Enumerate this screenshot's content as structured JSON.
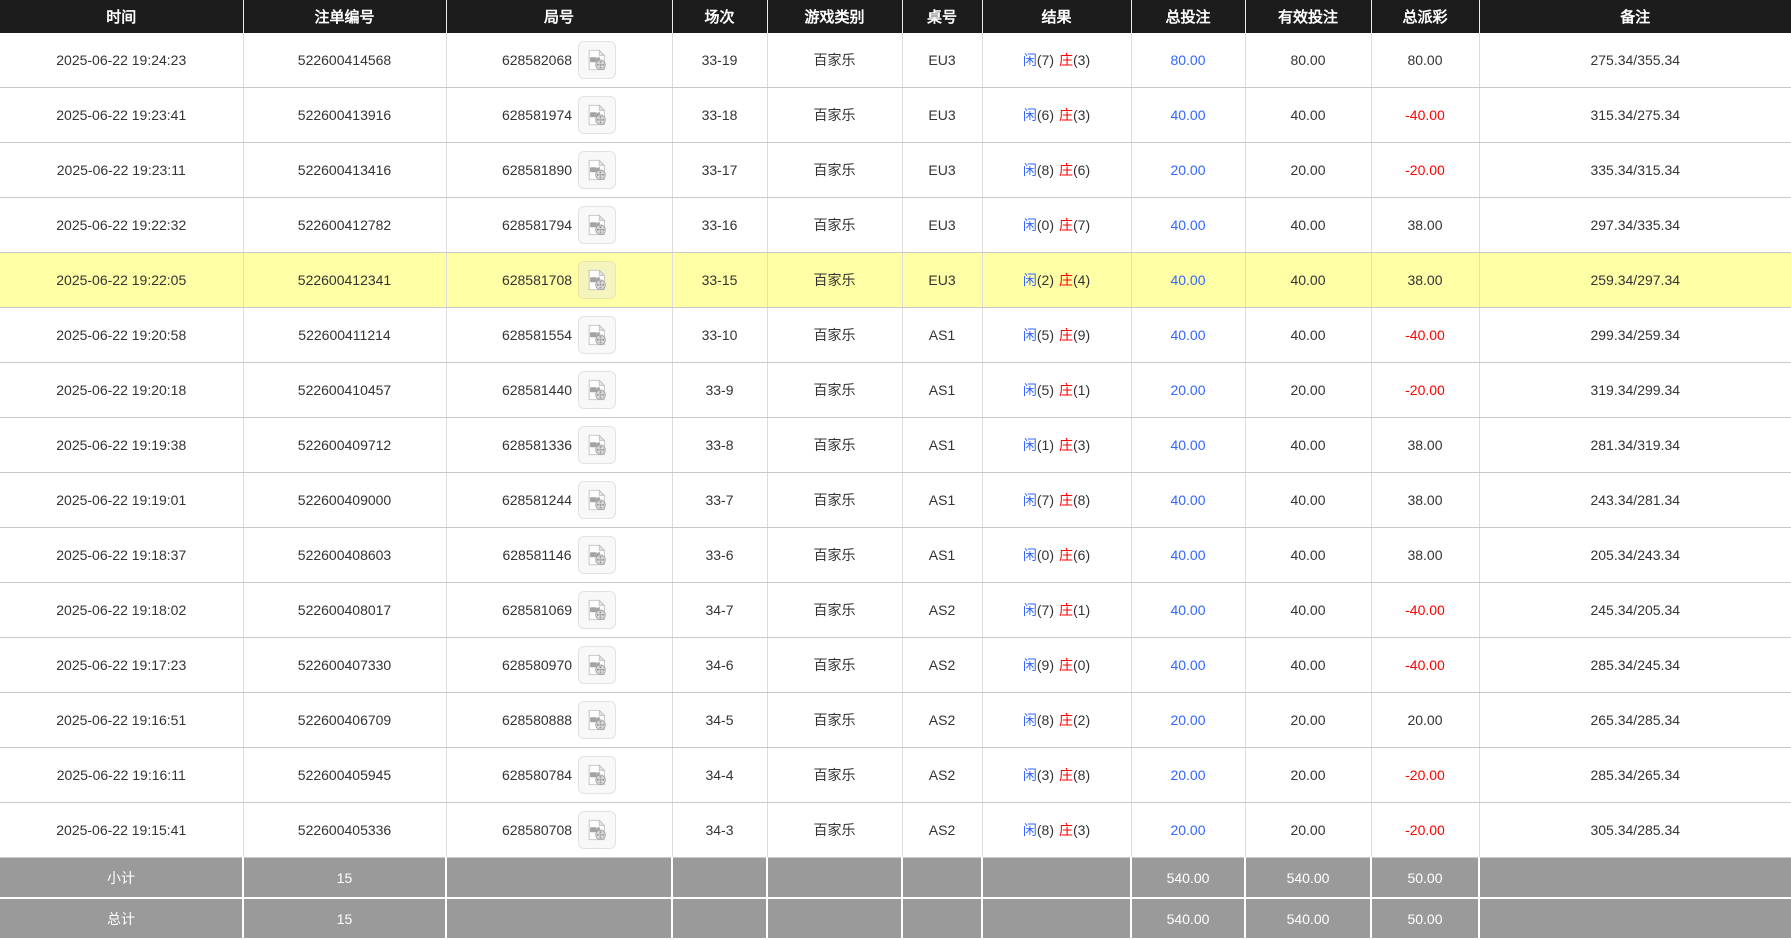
{
  "table": {
    "columns": [
      {
        "key": "time",
        "label": "时间"
      },
      {
        "key": "bet_id",
        "label": "注单编号"
      },
      {
        "key": "round",
        "label": "局号"
      },
      {
        "key": "session",
        "label": "场次"
      },
      {
        "key": "game_type",
        "label": "游戏类别"
      },
      {
        "key": "table_id",
        "label": "桌号"
      },
      {
        "key": "result",
        "label": "结果"
      },
      {
        "key": "total_bet",
        "label": "总投注"
      },
      {
        "key": "valid_bet",
        "label": "有效投注"
      },
      {
        "key": "payout",
        "label": "总派彩"
      },
      {
        "key": "remark",
        "label": "备注"
      }
    ],
    "rows": [
      {
        "time": "2025-06-22 19:24:23",
        "bet_id": "522600414568",
        "round": "628582068",
        "session": "33-19",
        "game_type": "百家乐",
        "table_id": "EU3",
        "result": {
          "player": "闲",
          "player_score": "(7)",
          "banker": "庄",
          "banker_score": "(3)"
        },
        "total_bet": "80.00",
        "valid_bet": "80.00",
        "payout": "80.00",
        "remark": "275.34/355.34",
        "highlighted": false
      },
      {
        "time": "2025-06-22 19:23:41",
        "bet_id": "522600413916",
        "round": "628581974",
        "session": "33-18",
        "game_type": "百家乐",
        "table_id": "EU3",
        "result": {
          "player": "闲",
          "player_score": "(6)",
          "banker": "庄",
          "banker_score": "(3)"
        },
        "total_bet": "40.00",
        "valid_bet": "40.00",
        "payout": "-40.00",
        "remark": "315.34/275.34",
        "highlighted": false
      },
      {
        "time": "2025-06-22 19:23:11",
        "bet_id": "522600413416",
        "round": "628581890",
        "session": "33-17",
        "game_type": "百家乐",
        "table_id": "EU3",
        "result": {
          "player": "闲",
          "player_score": "(8)",
          "banker": "庄",
          "banker_score": "(6)"
        },
        "total_bet": "20.00",
        "valid_bet": "20.00",
        "payout": "-20.00",
        "remark": "335.34/315.34",
        "highlighted": false
      },
      {
        "time": "2025-06-22 19:22:32",
        "bet_id": "522600412782",
        "round": "628581794",
        "session": "33-16",
        "game_type": "百家乐",
        "table_id": "EU3",
        "result": {
          "player": "闲",
          "player_score": "(0)",
          "banker": "庄",
          "banker_score": "(7)"
        },
        "total_bet": "40.00",
        "valid_bet": "40.00",
        "payout": "38.00",
        "remark": "297.34/335.34",
        "highlighted": false
      },
      {
        "time": "2025-06-22 19:22:05",
        "bet_id": "522600412341",
        "round": "628581708",
        "session": "33-15",
        "game_type": "百家乐",
        "table_id": "EU3",
        "result": {
          "player": "闲",
          "player_score": "(2)",
          "banker": "庄",
          "banker_score": "(4)"
        },
        "total_bet": "40.00",
        "valid_bet": "40.00",
        "payout": "38.00",
        "remark": "259.34/297.34",
        "highlighted": true
      },
      {
        "time": "2025-06-22 19:20:58",
        "bet_id": "522600411214",
        "round": "628581554",
        "session": "33-10",
        "game_type": "百家乐",
        "table_id": "AS1",
        "result": {
          "player": "闲",
          "player_score": "(5)",
          "banker": "庄",
          "banker_score": "(9)"
        },
        "total_bet": "40.00",
        "valid_bet": "40.00",
        "payout": "-40.00",
        "remark": "299.34/259.34",
        "highlighted": false
      },
      {
        "time": "2025-06-22 19:20:18",
        "bet_id": "522600410457",
        "round": "628581440",
        "session": "33-9",
        "game_type": "百家乐",
        "table_id": "AS1",
        "result": {
          "player": "闲",
          "player_score": "(5)",
          "banker": "庄",
          "banker_score": "(1)"
        },
        "total_bet": "20.00",
        "valid_bet": "20.00",
        "payout": "-20.00",
        "remark": "319.34/299.34",
        "highlighted": false
      },
      {
        "time": "2025-06-22 19:19:38",
        "bet_id": "522600409712",
        "round": "628581336",
        "session": "33-8",
        "game_type": "百家乐",
        "table_id": "AS1",
        "result": {
          "player": "闲",
          "player_score": "(1)",
          "banker": "庄",
          "banker_score": "(3)"
        },
        "total_bet": "40.00",
        "valid_bet": "40.00",
        "payout": "38.00",
        "remark": "281.34/319.34",
        "highlighted": false
      },
      {
        "time": "2025-06-22 19:19:01",
        "bet_id": "522600409000",
        "round": "628581244",
        "session": "33-7",
        "game_type": "百家乐",
        "table_id": "AS1",
        "result": {
          "player": "闲",
          "player_score": "(7)",
          "banker": "庄",
          "banker_score": "(8)"
        },
        "total_bet": "40.00",
        "valid_bet": "40.00",
        "payout": "38.00",
        "remark": "243.34/281.34",
        "highlighted": false
      },
      {
        "time": "2025-06-22 19:18:37",
        "bet_id": "522600408603",
        "round": "628581146",
        "session": "33-6",
        "game_type": "百家乐",
        "table_id": "AS1",
        "result": {
          "player": "闲",
          "player_score": "(0)",
          "banker": "庄",
          "banker_score": "(6)"
        },
        "total_bet": "40.00",
        "valid_bet": "40.00",
        "payout": "38.00",
        "remark": "205.34/243.34",
        "highlighted": false
      },
      {
        "time": "2025-06-22 19:18:02",
        "bet_id": "522600408017",
        "round": "628581069",
        "session": "34-7",
        "game_type": "百家乐",
        "table_id": "AS2",
        "result": {
          "player": "闲",
          "player_score": "(7)",
          "banker": "庄",
          "banker_score": "(1)"
        },
        "total_bet": "40.00",
        "valid_bet": "40.00",
        "payout": "-40.00",
        "remark": "245.34/205.34",
        "highlighted": false
      },
      {
        "time": "2025-06-22 19:17:23",
        "bet_id": "522600407330",
        "round": "628580970",
        "session": "34-6",
        "game_type": "百家乐",
        "table_id": "AS2",
        "result": {
          "player": "闲",
          "player_score": "(9)",
          "banker": "庄",
          "banker_score": "(0)"
        },
        "total_bet": "40.00",
        "valid_bet": "40.00",
        "payout": "-40.00",
        "remark": "285.34/245.34",
        "highlighted": false
      },
      {
        "time": "2025-06-22 19:16:51",
        "bet_id": "522600406709",
        "round": "628580888",
        "session": "34-5",
        "game_type": "百家乐",
        "table_id": "AS2",
        "result": {
          "player": "闲",
          "player_score": "(8)",
          "banker": "庄",
          "banker_score": "(2)"
        },
        "total_bet": "20.00",
        "valid_bet": "20.00",
        "payout": "20.00",
        "remark": "265.34/285.34",
        "highlighted": false
      },
      {
        "time": "2025-06-22 19:16:11",
        "bet_id": "522600405945",
        "round": "628580784",
        "session": "34-4",
        "game_type": "百家乐",
        "table_id": "AS2",
        "result": {
          "player": "闲",
          "player_score": "(3)",
          "banker": "庄",
          "banker_score": "(8)"
        },
        "total_bet": "20.00",
        "valid_bet": "20.00",
        "payout": "-20.00",
        "remark": "285.34/265.34",
        "highlighted": false
      },
      {
        "time": "2025-06-22 19:15:41",
        "bet_id": "522600405336",
        "round": "628580708",
        "session": "34-3",
        "game_type": "百家乐",
        "table_id": "AS2",
        "result": {
          "player": "闲",
          "player_score": "(8)",
          "banker": "庄",
          "banker_score": "(3)"
        },
        "total_bet": "20.00",
        "valid_bet": "20.00",
        "payout": "-20.00",
        "remark": "305.34/285.34",
        "highlighted": false
      }
    ],
    "footer": [
      {
        "label": "小计",
        "count": "15",
        "total_bet": "540.00",
        "valid_bet": "540.00",
        "payout": "50.00"
      },
      {
        "label": "总计",
        "count": "15",
        "total_bet": "540.00",
        "valid_bet": "540.00",
        "payout": "50.00"
      }
    ]
  },
  "icons": {
    "round_column_icon": "video-playback-icon"
  },
  "colors": {
    "header_bg": "#1c1c1c",
    "header_text": "#ffffff",
    "total_bet_blue": "#3366ff",
    "player_blue": "#3366ff",
    "banker_red": "#ff0000",
    "negative_red": "#ff0000",
    "highlight_yellow": "#ffffa6",
    "footer_gray": "#9a9a9a",
    "body_text": "#333333"
  }
}
